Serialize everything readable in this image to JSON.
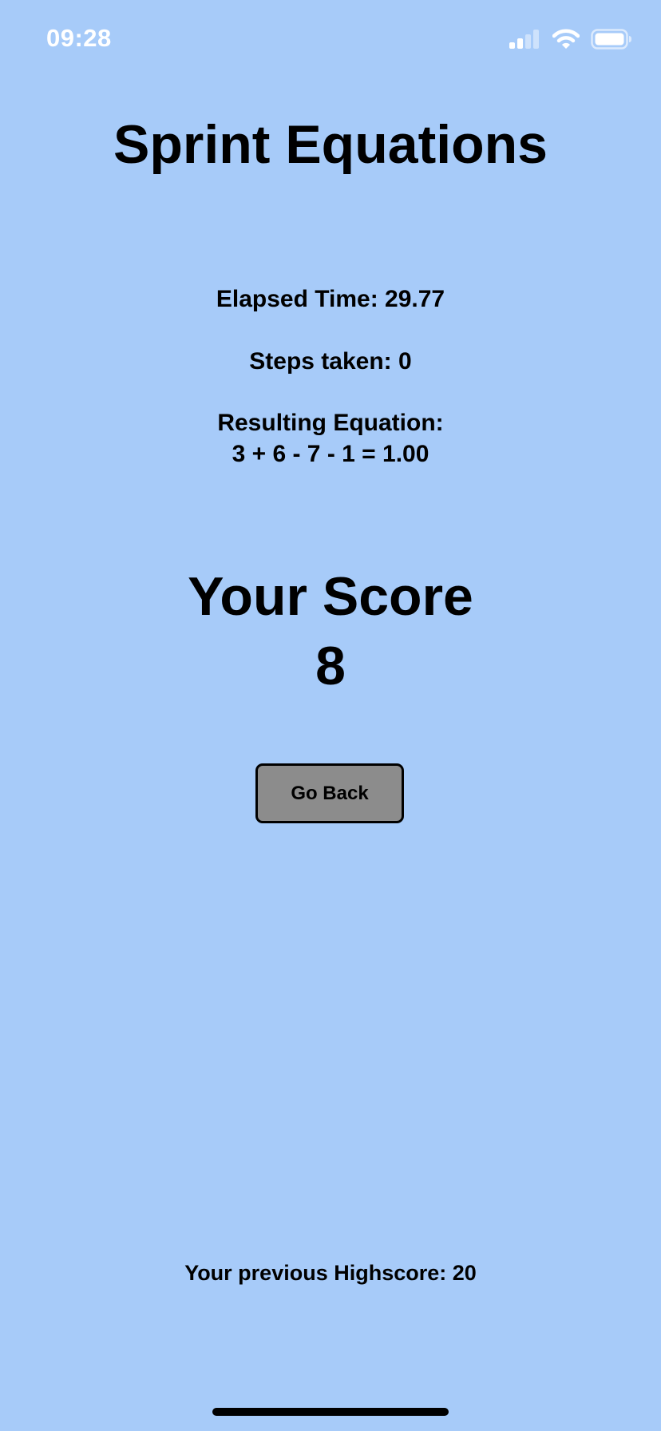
{
  "status_bar": {
    "time": "09:28",
    "icons": [
      "signal-icon",
      "wifi-icon",
      "battery-icon"
    ],
    "icon_color": "#ffffff"
  },
  "app": {
    "title": "Sprint Equations",
    "background_color": "#a7cbf9"
  },
  "results": {
    "elapsed_time": "Elapsed Time: 29.77",
    "steps_taken": "Steps taken: 0",
    "equation_label": "Resulting Equation:",
    "equation_value": "3 + 6 - 7 - 1 = 1.00"
  },
  "score": {
    "label": "Your Score",
    "value": "8"
  },
  "actions": {
    "go_back_label": "Go Back",
    "button_color": "#8c8c8c"
  },
  "footer": {
    "highscore_text": "Your previous Highscore: 20"
  }
}
